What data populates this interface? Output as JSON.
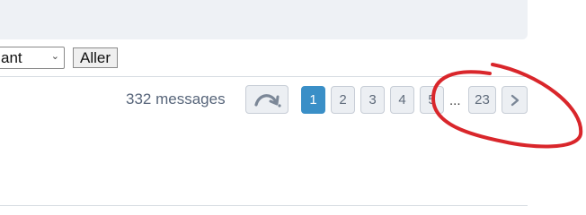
{
  "toolbar": {
    "sort_value": "ant",
    "go_label": "Aller"
  },
  "pagination": {
    "message_count": "332 messages",
    "pages": [
      "1",
      "2",
      "3",
      "4",
      "5"
    ],
    "active_page": "1",
    "ellipsis": "...",
    "last_page": "23",
    "jump_icon": "jump-to-page-icon",
    "next_icon": "chevron-right-icon"
  },
  "annotation": {
    "color": "#d9262b",
    "shape": "hand-drawn circle around last page and next buttons"
  }
}
